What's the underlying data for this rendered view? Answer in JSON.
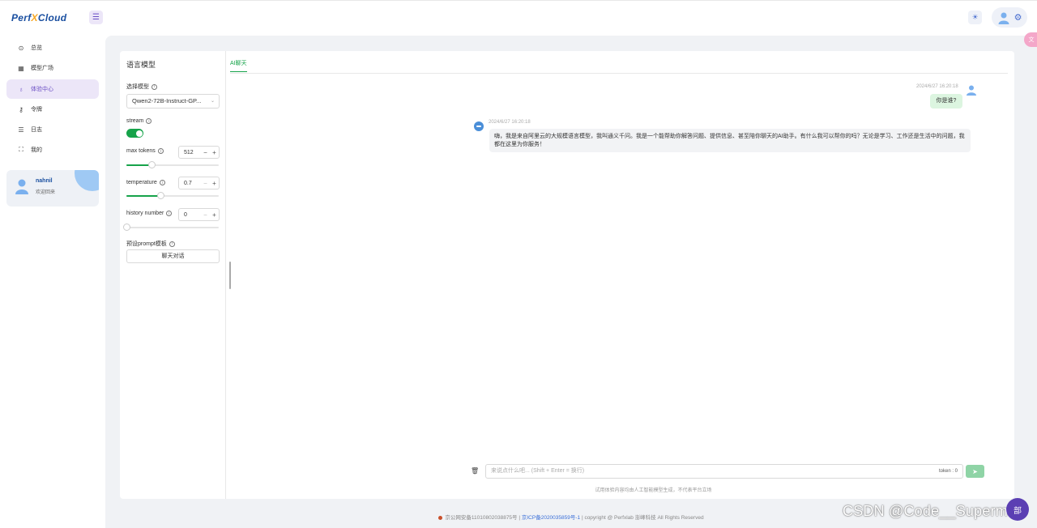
{
  "header": {
    "logo_prefix": "Perf",
    "logo_x": "X",
    "logo_suffix": "Cloud"
  },
  "sidebar": {
    "items": [
      {
        "label": "总览",
        "icon": "compass-icon"
      },
      {
        "label": "模型广场",
        "icon": "grid-icon"
      },
      {
        "label": "体验中心",
        "icon": "experience-icon",
        "active": true
      },
      {
        "label": "令牌",
        "icon": "key-icon"
      },
      {
        "label": "日志",
        "icon": "log-icon"
      },
      {
        "label": "我的",
        "icon": "scan-user-icon"
      }
    ],
    "user": {
      "name": "nahnil",
      "welcome": "欢迎回来"
    }
  },
  "settings": {
    "title": "语言模型",
    "model_label": "选择模型",
    "model_value": "Qwen2-72B-Instruct-GP...",
    "stream_label": "stream",
    "stream_on": true,
    "max_tokens_label": "max tokens",
    "max_tokens_value": "512",
    "max_tokens_fraction": 0.27,
    "temperature_label": "temperature",
    "temperature_value": "0.7",
    "temperature_fraction": 0.37,
    "history_label": "history number",
    "history_value": "0",
    "history_fraction": 0.0,
    "prompt_label": "预设prompt模板",
    "prompt_button": "聊天对话"
  },
  "chat": {
    "tab": "AI聊天",
    "user_time": "2024/6/27 16:20:18",
    "user_message": "你是谁?",
    "ai_time": "2024/6/27 16:20:18",
    "ai_message": "嗨，我是来自阿里云的大规模语言模型，我叫通义千问。我是一个能帮助你解答问题、提供信息、甚至陪你聊天的AI助手。有什么我可以帮你的吗？无论是学习、工作还是生活中的问题，我都在这里为你服务！",
    "input_placeholder": "来说点什么吧... (Shift + Enter = 换行)",
    "token_label": "token : 0",
    "disclaimer": "试用体验内容均由人工智能模型生成，不代表平台立场"
  },
  "footer": {
    "police": "京公网安备11010802038875号",
    "sep1": " | ",
    "icp": "京ICP备2020035859号-1",
    "copyright": " | copyright @ Perfxlab 澎峰科技 All Rights Reserved"
  },
  "watermark": "CSDN @Code__Superman",
  "fab_label": "部"
}
